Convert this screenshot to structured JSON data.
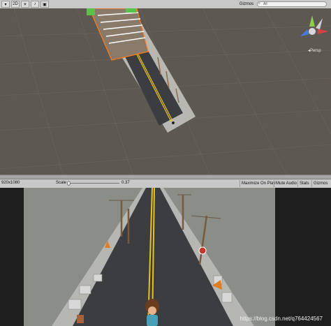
{
  "scene_toolbar": {
    "mode_2d": "2D",
    "gizmos_label": "Gizmos",
    "search_placeholder": "All"
  },
  "scene_view": {
    "persp_label": "◂Persp"
  },
  "game_toolbar": {
    "resolution": "920x1080",
    "scale_label": "Scale",
    "scale_value": "0.37",
    "maximize_on_play": "Maximize On Play",
    "mute_audio": "Mute Audio",
    "stats": "Stats",
    "gizmos": "Gizmos"
  },
  "watermark": "https://blog.csdn.net/q764424567",
  "colors": {
    "scene_bg": "#5e5853",
    "toolbar": "#c8c8c8",
    "game_bg": "#8b8e87",
    "road": "#3b3d41",
    "center_line": "#e8c21c"
  },
  "icons": [
    "light-icon",
    "audio-icon",
    "effects-icon",
    "scene-gizmo-icon",
    "search-icon"
  ]
}
